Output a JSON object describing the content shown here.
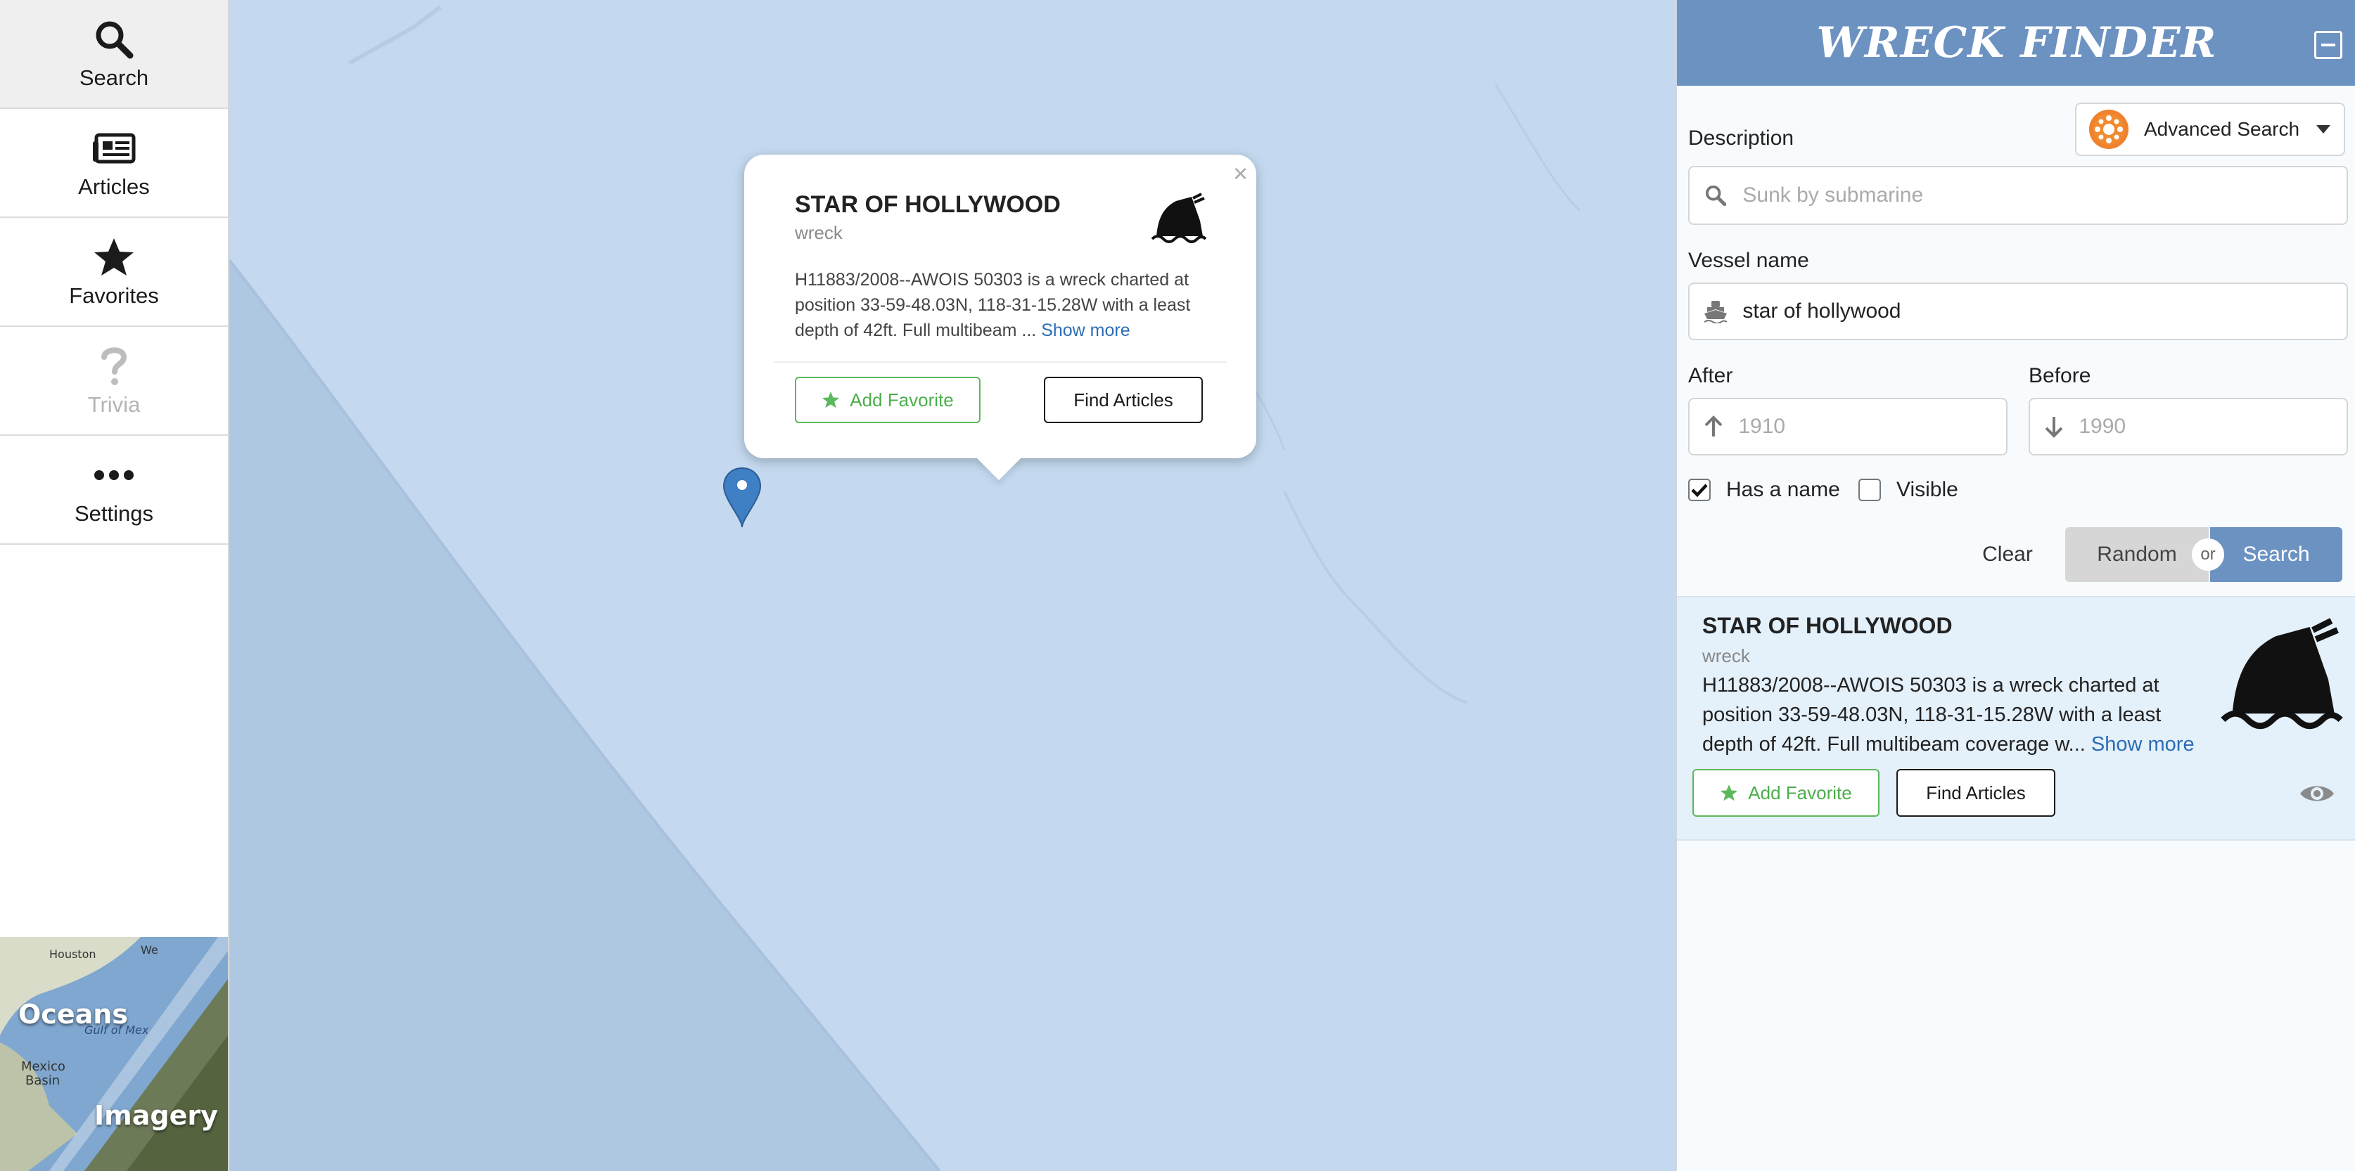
{
  "sidebar": {
    "items": [
      {
        "label": "Search",
        "icon": "search-icon"
      },
      {
        "label": "Articles",
        "icon": "newspaper-icon"
      },
      {
        "label": "Favorites",
        "icon": "star-icon"
      },
      {
        "label": "Trivia",
        "icon": "question-icon"
      },
      {
        "label": "Settings",
        "icon": "ellipsis-icon"
      }
    ],
    "layer_toggle": {
      "left_label": "Oceans",
      "right_label": "Imagery",
      "map_labels": [
        "Houston",
        "Gulf of Mex",
        "Mexico",
        "Basin",
        "We"
      ]
    }
  },
  "popup": {
    "title": "STAR OF HOLLYWOOD",
    "subtitle": "wreck",
    "description": "H11883/2008--AWOIS 50303 is a wreck charted at position 33-59-48.03N, 118-31-15.28W with a least depth of 42ft. Full multibeam ...",
    "show_more": "Show more",
    "add_favorite": "Add Favorite",
    "find_articles": "Find Articles",
    "close": "×"
  },
  "panel": {
    "brand": "WRECK FINDER",
    "advanced_search": "Advanced Search",
    "description_label": "Description",
    "description_placeholder": "Sunk by submarine",
    "vessel_label": "Vessel name",
    "vessel_value": "star of hollywood",
    "after_label": "After",
    "after_placeholder": "1910",
    "before_label": "Before",
    "before_placeholder": "1990",
    "has_name_label": "Has a name",
    "has_name_checked": true,
    "visible_label": "Visible",
    "visible_checked": false,
    "clear": "Clear",
    "random": "Random",
    "or": "or",
    "search": "Search"
  },
  "result": {
    "title": "STAR OF HOLLYWOOD",
    "subtitle": "wreck",
    "description": "H11883/2008--AWOIS 50303 is a wreck charted at position 33-59-48.03N, 118-31-15.28W with a least depth of 42ft. Full multibeam coverage w...",
    "show_more": "Show more",
    "add_favorite": "Add Favorite",
    "find_articles": "Find Articles"
  },
  "colors": {
    "header": "#6c92c2",
    "map_ocean": "#c3d8ef",
    "favorite_green": "#5cb85c",
    "link_blue": "#2c6db5",
    "search_button": "#6c92c2",
    "random_button": "#d6d6d6"
  }
}
